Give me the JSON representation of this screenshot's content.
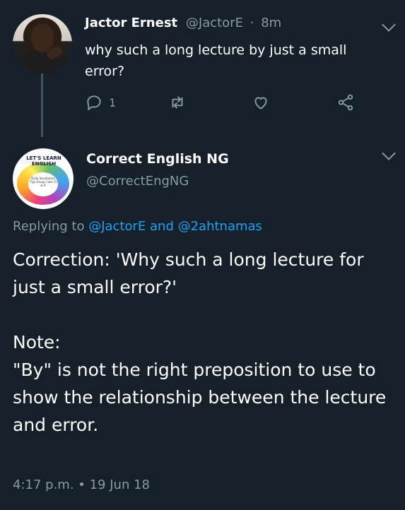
{
  "tweet1": {
    "name": "Jactor Ernest",
    "handle": "@JactorE",
    "time": "8m",
    "text": "why such a long lecture by just a small error?",
    "reply_count": "1"
  },
  "tweet2": {
    "name": "Correct English NG",
    "handle": "@CorrectEngNG",
    "avatar_title": "LET'S LEARN ENGLISH",
    "avatar_sub": "Daily Vocabulary Tips Group Class Q & A",
    "replying_prefix": "Replying to",
    "replying_to": "@JactorE and @2ahtnamas",
    "paragraph1": "Correction: 'Why such a long lecture for just a small error?'",
    "paragraph2_heading": "Note:",
    "paragraph2": "\"By\" is not the right preposition to use to show the relationship between the lecture and error.",
    "timestamp": "4:17 p.m. • 19 Jun 18"
  },
  "colors": {
    "background": "#15202b",
    "secondary_text": "#8899a6",
    "link": "#1da1f2"
  },
  "icons": [
    "reply-icon",
    "retweet-icon",
    "like-icon",
    "share-icon",
    "chevron-down-icon"
  ]
}
